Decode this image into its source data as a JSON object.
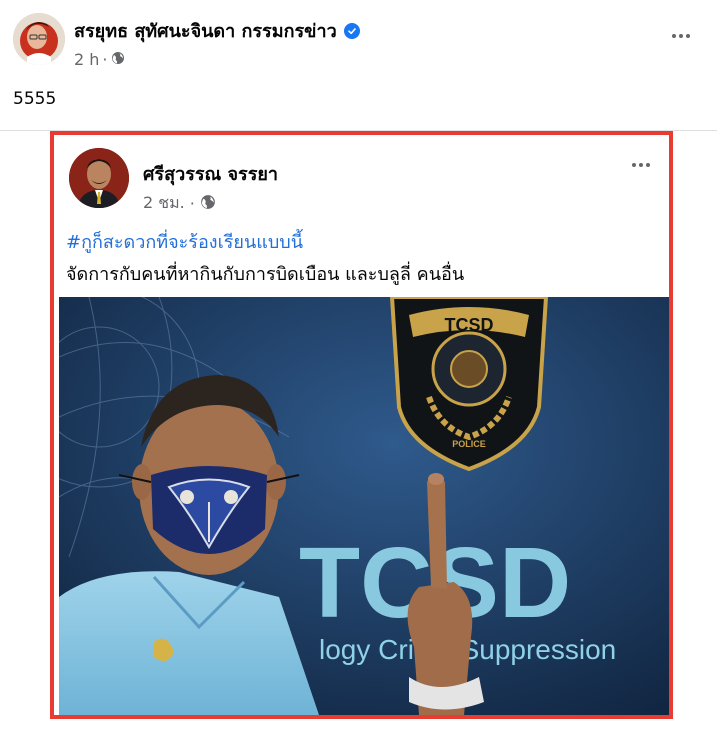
{
  "post": {
    "author": "สรยุทธ สุทัศนะจินดา กรรมกรข่าว",
    "timestamp": "2 h",
    "privacy_icon": "globe-icon",
    "verified_icon": "verified-badge-icon",
    "text": "5555"
  },
  "shared_post": {
    "author": "ศรีสุวรรณ จรรยา",
    "timestamp": "2 ชม.",
    "privacy_icon": "globe-icon",
    "hashtag": "#กูก็สะดวกที่จะร้องเรียนแบบนี้",
    "text": "จัดการกับคนที่หากินกับการบิดเบือน และบลูลี่ คนอื่น",
    "photo": {
      "badge_top": "TCSD",
      "badge_bottom": "POLICE",
      "wall_logo": "TCSD",
      "wall_tagline": "logy Crime Suppression"
    }
  },
  "colors": {
    "highlight_border": "#e83c32",
    "hashtag": "#216fdb",
    "verified": "#1877f2",
    "meta_text": "#65676b"
  }
}
